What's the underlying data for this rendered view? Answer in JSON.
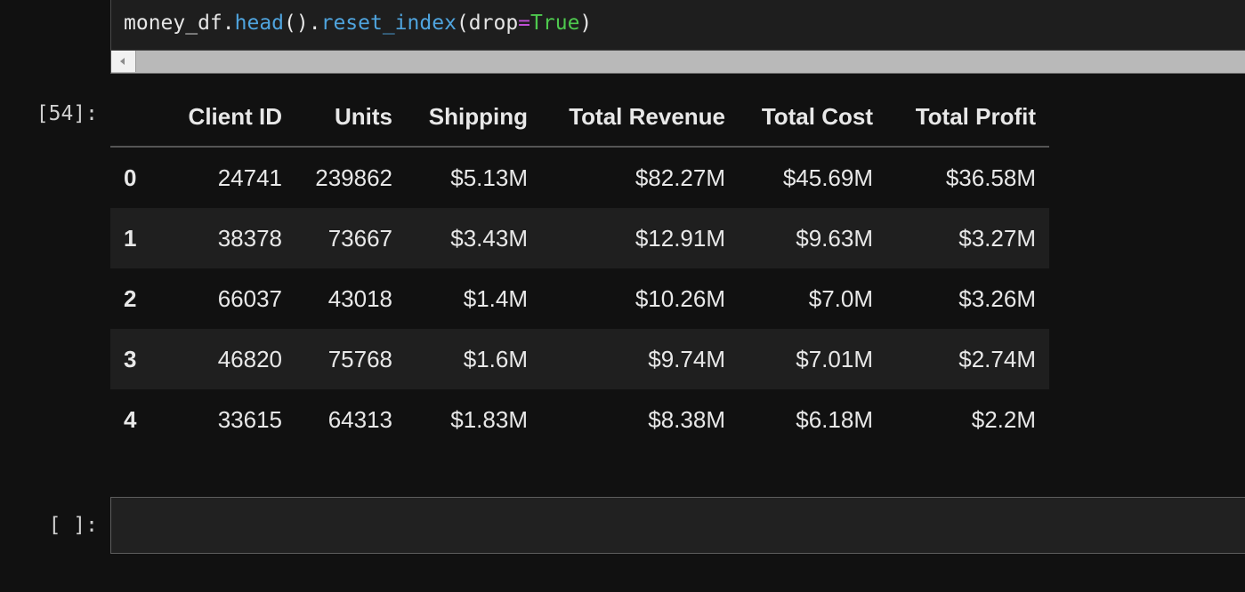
{
  "code_cell": {
    "tokens": {
      "var": "money_df",
      "dot1": ".",
      "fn1": "head",
      "parens1": "()",
      "dot2": ".",
      "fn2": "reset_index",
      "open": "(",
      "arg": "drop",
      "eq": "=",
      "val": "True",
      "close": ")"
    }
  },
  "output_cell": {
    "prompt": "[54]:",
    "table": {
      "columns": [
        "",
        "Client ID",
        "Units",
        "Shipping",
        "Total Revenue",
        "Total Cost",
        "Total Profit"
      ],
      "rows": [
        [
          "0",
          "24741",
          "239862",
          "$5.13M",
          "$82.27M",
          "$45.69M",
          "$36.58M"
        ],
        [
          "1",
          "38378",
          "73667",
          "$3.43M",
          "$12.91M",
          "$9.63M",
          "$3.27M"
        ],
        [
          "2",
          "66037",
          "43018",
          "$1.4M",
          "$10.26M",
          "$7.0M",
          "$3.26M"
        ],
        [
          "3",
          "46820",
          "75768",
          "$1.6M",
          "$9.74M",
          "$7.01M",
          "$2.74M"
        ],
        [
          "4",
          "33615",
          "64313",
          "$1.83M",
          "$8.38M",
          "$6.18M",
          "$2.2M"
        ]
      ]
    }
  },
  "empty_cell": {
    "prompt": "[ ]:"
  },
  "colors": {
    "background": "#111111",
    "cell_background": "#1e1e1e",
    "function_token": "#4fa4de",
    "operator_token": "#c050d6",
    "keyword_token": "#4ec94e",
    "striped_row": "#1f1f1f"
  }
}
